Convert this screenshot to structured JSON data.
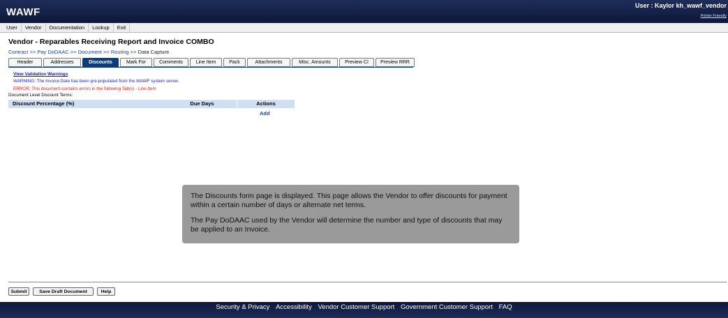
{
  "app": {
    "logo": "WAWF",
    "user_label": "User : Kaylor kh_wawf_vendor",
    "printer_friendly": "Printer Friendly"
  },
  "menu": [
    "User",
    "Vendor",
    "Documentation",
    "Lookup",
    "Exit"
  ],
  "page": {
    "title": "Vendor - Reparables Receiving Report and Invoice COMBO",
    "breadcrumb": {
      "contract": "Contract",
      "pay_dodaac": "Pay DoDAAC",
      "document": "Document",
      "routing": "Routing",
      "current": "Data Capture",
      "sep": ">>"
    }
  },
  "tabs": [
    "Header",
    "Addresses",
    "Discounts",
    "Mark For",
    "Comments",
    "Line Item",
    "Pack",
    "Attachments",
    "Misc. Amounts",
    "Preview CI",
    "Preview RRR"
  ],
  "active_tab": "Discounts",
  "messages": {
    "validation_link": "View Validation Warnings",
    "warning": "WARNING: The Invoice Date has been pre-populated from the WAWF system server.",
    "error": "ERROR: This document contains errors in the following Tab(s) - Line Item",
    "doc_level_label": "Document Level Discount Terms:"
  },
  "table": {
    "headers": [
      "Discount Percentage (%)",
      "Due Days",
      "Actions"
    ],
    "add_label": "Add"
  },
  "callout": {
    "p1": "The Discounts form page is displayed. This page allows the Vendor to offer discounts for payment within a certain number of days or alternate net terms.",
    "p2": "The Pay DoDAAC used by the Vendor will determine the number and type of discounts that may be applied to an Invoice."
  },
  "buttons": {
    "submit": "Submit",
    "save_draft": "Save Draft Document",
    "help": "Help"
  },
  "footer": [
    "Security & Privacy",
    "Accessibility",
    "Vendor Customer Support",
    "Government Customer Support",
    "FAQ"
  ],
  "colors": {
    "header_bg": "#1f2d5a",
    "active_tab": "#0c3d7a",
    "table_header": "#cfe0f5",
    "callout": "#9a9a9a"
  }
}
